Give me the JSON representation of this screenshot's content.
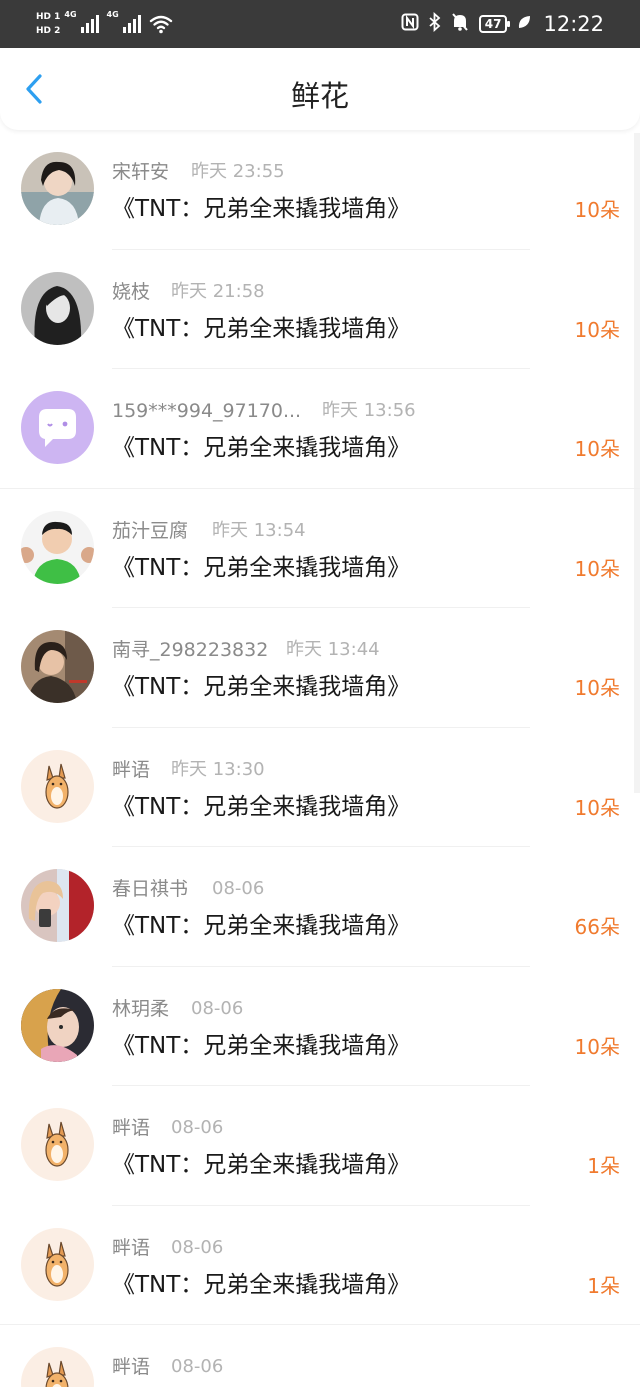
{
  "status_bar": {
    "hd1": "HD 1",
    "hd2": "HD 2",
    "net1": "4G",
    "net2": "4G",
    "battery": "47",
    "time": "12:22"
  },
  "header": {
    "title": "鲜花",
    "back_icon": "chevron-left-icon"
  },
  "colors": {
    "accent_blue": "#2d9ff0",
    "count_orange": "#f07a2e"
  },
  "items": [
    {
      "name": "宋轩安",
      "time": "昨天 23:55",
      "book": "《TNT：兄弟全来撬我墙角》",
      "count": "10朵"
    },
    {
      "name": "娆枝",
      "time": "昨天 21:58",
      "book": "《TNT：兄弟全来撬我墙角》",
      "count": "10朵"
    },
    {
      "name": "159***994_97170...",
      "time": "昨天 13:56",
      "book": "《TNT：兄弟全来撬我墙角》",
      "count": "10朵"
    },
    {
      "name": "茄汁豆腐",
      "time": "昨天 13:54",
      "book": "《TNT：兄弟全来撬我墙角》",
      "count": "10朵"
    },
    {
      "name": "南寻_298223832",
      "time": "昨天 13:44",
      "book": "《TNT：兄弟全来撬我墙角》",
      "count": "10朵"
    },
    {
      "name": "畔语",
      "time": "昨天 13:30",
      "book": "《TNT：兄弟全来撬我墙角》",
      "count": "10朵"
    },
    {
      "name": "春日祺书",
      "time": "08-06",
      "book": "《TNT：兄弟全来撬我墙角》",
      "count": "66朵"
    },
    {
      "name": "林玥柔",
      "time": "08-06",
      "book": "《TNT：兄弟全来撬我墙角》",
      "count": "10朵"
    },
    {
      "name": "畔语",
      "time": "08-06",
      "book": "《TNT：兄弟全来撬我墙角》",
      "count": "1朵"
    },
    {
      "name": "畔语",
      "time": "08-06",
      "book": "《TNT：兄弟全来撬我墙角》",
      "count": "1朵"
    },
    {
      "name": "畔语",
      "time": "08-06",
      "book": "",
      "count": ""
    }
  ]
}
